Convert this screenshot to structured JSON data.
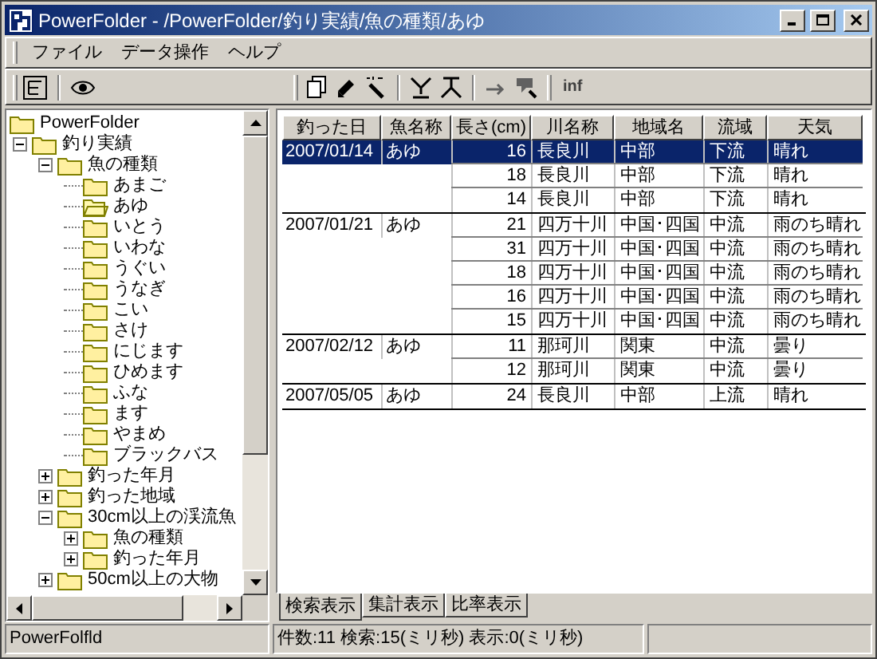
{
  "window": {
    "title": "PowerFolder - /PowerFolder/釣り実績/魚の種類/あゆ"
  },
  "menu": [
    "ファイル",
    "データ操作",
    "ヘルプ"
  ],
  "toolbar": {
    "label": "inf"
  },
  "tree": [
    {
      "label": "PowerFolder",
      "kind": "root",
      "selected": false,
      "children": [
        {
          "label": "釣り実績",
          "kind": "node",
          "expanded": true,
          "selected": false,
          "children": [
            {
              "label": "魚の種類",
              "kind": "node",
              "expanded": true,
              "selected": false,
              "children": [
                {
                  "label": "あまご",
                  "kind": "leaf",
                  "selected": false
                },
                {
                  "label": "あゆ",
                  "kind": "leaf",
                  "selected": true
                },
                {
                  "label": "いとう",
                  "kind": "leaf",
                  "selected": false
                },
                {
                  "label": "いわな",
                  "kind": "leaf",
                  "selected": false
                },
                {
                  "label": "うぐい",
                  "kind": "leaf",
                  "selected": false
                },
                {
                  "label": "うなぎ",
                  "kind": "leaf",
                  "selected": false
                },
                {
                  "label": "こい",
                  "kind": "leaf",
                  "selected": false
                },
                {
                  "label": "さけ",
                  "kind": "leaf",
                  "selected": false
                },
                {
                  "label": "にじます",
                  "kind": "leaf",
                  "selected": false
                },
                {
                  "label": "ひめます",
                  "kind": "leaf",
                  "selected": false
                },
                {
                  "label": "ふな",
                  "kind": "leaf",
                  "selected": false
                },
                {
                  "label": "ます",
                  "kind": "leaf",
                  "selected": false
                },
                {
                  "label": "やまめ",
                  "kind": "leaf",
                  "selected": false
                },
                {
                  "label": "ブラックバス",
                  "kind": "leaf",
                  "selected": false
                }
              ]
            },
            {
              "label": "釣った年月",
              "kind": "node",
              "expanded": false,
              "selected": false
            },
            {
              "label": "釣った地域",
              "kind": "node",
              "expanded": false,
              "selected": false
            },
            {
              "label": "30cm以上の渓流魚",
              "kind": "node",
              "expanded": true,
              "selected": false,
              "children": [
                {
                  "label": "魚の種類",
                  "kind": "node",
                  "expanded": false,
                  "selected": false
                },
                {
                  "label": "釣った年月",
                  "kind": "node",
                  "expanded": false,
                  "selected": false
                }
              ]
            },
            {
              "label": "50cm以上の大物",
              "kind": "node",
              "expanded": false,
              "selected": false
            }
          ]
        }
      ]
    }
  ],
  "table": {
    "columns": [
      "釣った日",
      "魚名称",
      "長さ(cm)",
      "川名称",
      "地域名",
      "流域",
      "天気"
    ],
    "groups": [
      {
        "date": "2007/01/14",
        "fish": "あゆ",
        "selected": true,
        "rows": [
          {
            "length": "16",
            "river": "長良川",
            "region": "中部",
            "basin": "下流",
            "weather": "晴れ",
            "selected": true
          },
          {
            "length": "18",
            "river": "長良川",
            "region": "中部",
            "basin": "下流",
            "weather": "晴れ",
            "selected": false
          },
          {
            "length": "14",
            "river": "長良川",
            "region": "中部",
            "basin": "下流",
            "weather": "晴れ",
            "selected": false
          }
        ]
      },
      {
        "date": "2007/01/21",
        "fish": "あゆ",
        "selected": false,
        "rows": [
          {
            "length": "21",
            "river": "四万十川",
            "region": "中国･四国",
            "basin": "中流",
            "weather": "雨のち晴れ",
            "selected": false
          },
          {
            "length": "31",
            "river": "四万十川",
            "region": "中国･四国",
            "basin": "中流",
            "weather": "雨のち晴れ",
            "selected": false
          },
          {
            "length": "18",
            "river": "四万十川",
            "region": "中国･四国",
            "basin": "中流",
            "weather": "雨のち晴れ",
            "selected": false
          },
          {
            "length": "16",
            "river": "四万十川",
            "region": "中国･四国",
            "basin": "中流",
            "weather": "雨のち晴れ",
            "selected": false
          },
          {
            "length": "15",
            "river": "四万十川",
            "region": "中国･四国",
            "basin": "中流",
            "weather": "雨のち晴れ",
            "selected": false
          }
        ]
      },
      {
        "date": "2007/02/12",
        "fish": "あゆ",
        "selected": false,
        "rows": [
          {
            "length": "11",
            "river": "那珂川",
            "region": "関東",
            "basin": "中流",
            "weather": "曇り",
            "selected": false
          },
          {
            "length": "12",
            "river": "那珂川",
            "region": "関東",
            "basin": "中流",
            "weather": "曇り",
            "selected": false
          }
        ]
      },
      {
        "date": "2007/05/05",
        "fish": "あゆ",
        "selected": false,
        "rows": [
          {
            "length": "24",
            "river": "長良川",
            "region": "中部",
            "basin": "上流",
            "weather": "晴れ",
            "selected": false
          }
        ]
      }
    ]
  },
  "tabs": [
    {
      "label": "検索表示",
      "selected": true
    },
    {
      "label": "集計表示",
      "selected": false
    },
    {
      "label": "比率表示",
      "selected": false
    }
  ],
  "status_bar": {
    "file": "PowerFolfld",
    "info": "件数:11 検索:15(ミリ秒) 表示:0(ミリ秒)"
  }
}
